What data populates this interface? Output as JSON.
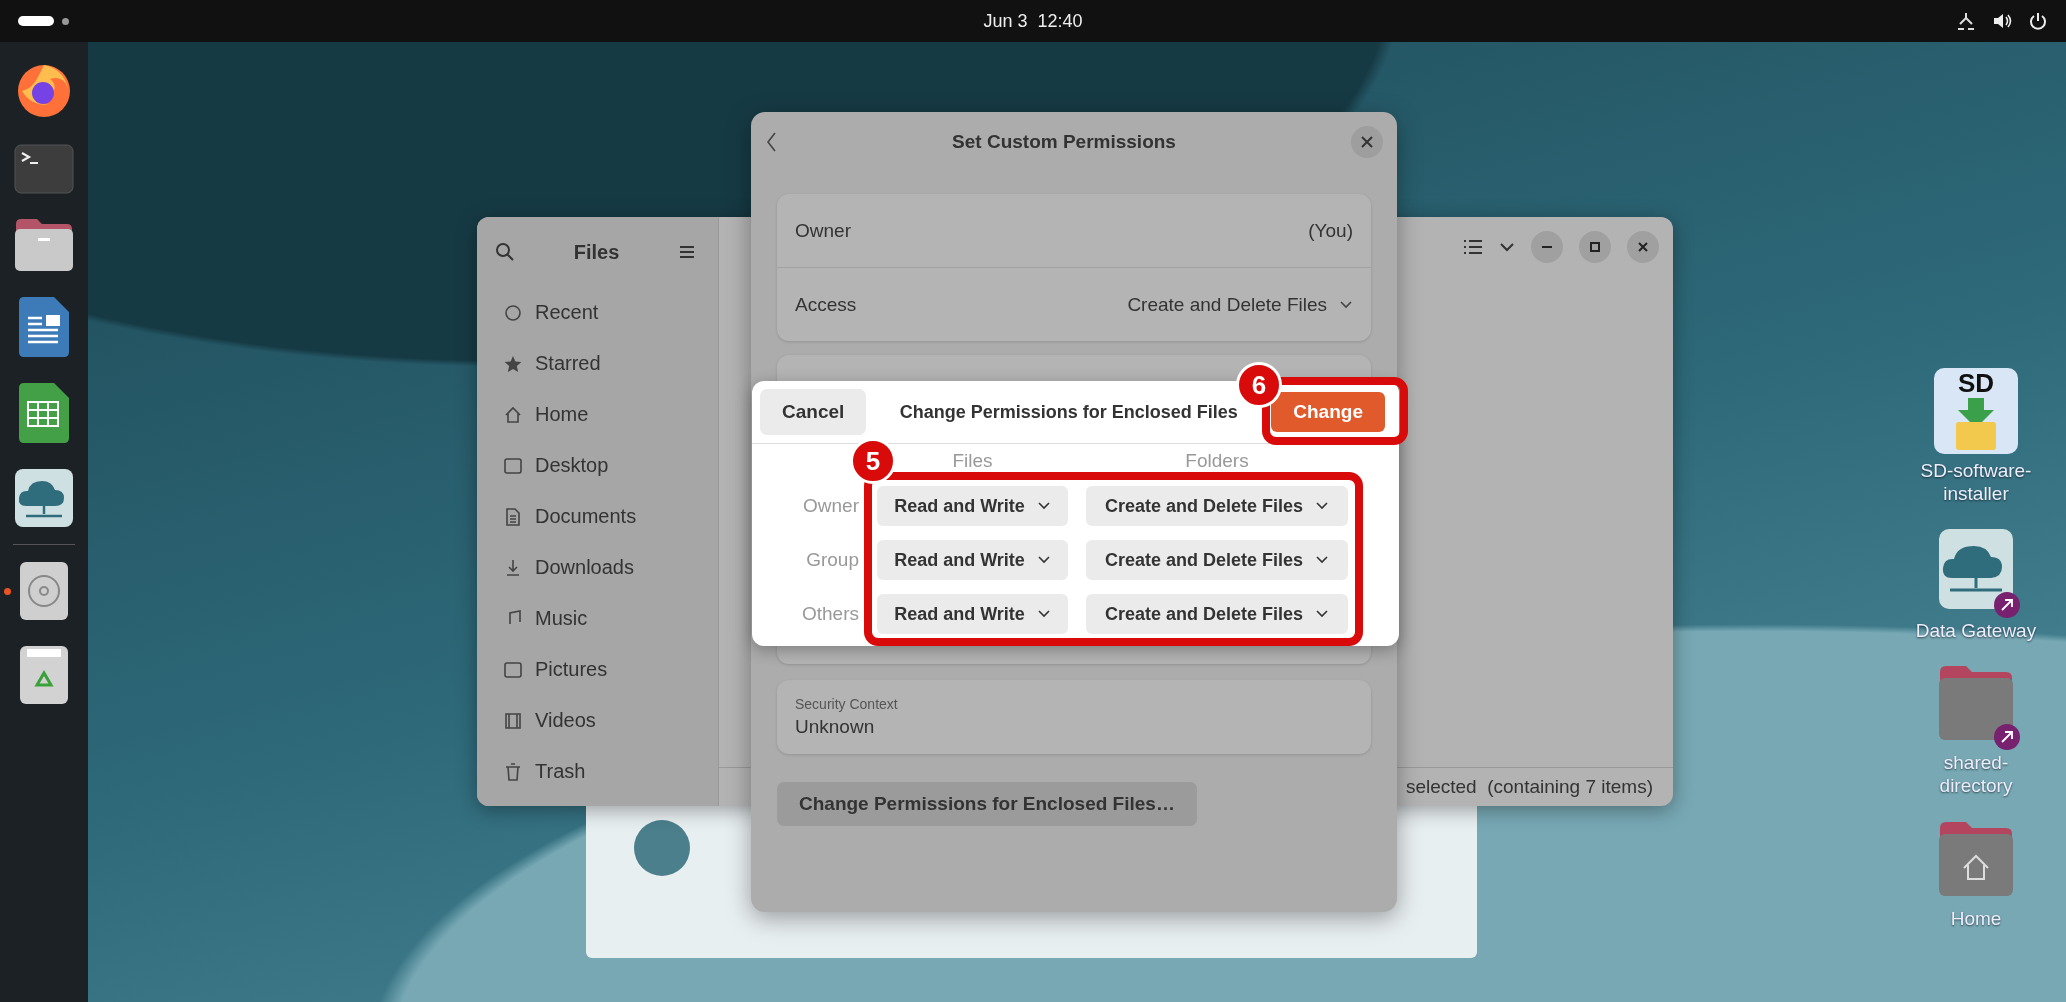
{
  "top_bar": {
    "clock": "Jun 3  12:40"
  },
  "dock": {
    "favorites": [
      {
        "running": false
      },
      {
        "running": false
      },
      {
        "running": false
      },
      {
        "running": false
      },
      {
        "running": false
      },
      {
        "running": false
      }
    ],
    "others": [
      {
        "running": true
      },
      {
        "running": false
      }
    ]
  },
  "files_window": {
    "title": "Files",
    "sidebar": [
      {
        "label": "Recent"
      },
      {
        "label": "Starred"
      },
      {
        "label": "Home"
      },
      {
        "label": "Desktop"
      },
      {
        "label": "Documents"
      },
      {
        "label": "Downloads"
      },
      {
        "label": "Music"
      },
      {
        "label": "Pictures"
      },
      {
        "label": "Videos"
      },
      {
        "label": "Trash"
      }
    ],
    "status": "selected  (containing 7 items)"
  },
  "permissions_dialog": {
    "title": "Set Custom Permissions",
    "owner": {
      "label": "Owner",
      "value": "(You)"
    },
    "access": {
      "label": "Access",
      "value": "Create and Delete Files"
    },
    "security_context": {
      "label": "Security Context",
      "value": "Unknown"
    },
    "enclosed_button": "Change Permissions for Enclosed Files…"
  },
  "enclosed_dialog": {
    "cancel": "Cancel",
    "title": "Change Permissions for Enclosed Files",
    "confirm": "Change",
    "columns": [
      "Files",
      "Folders"
    ],
    "rows": [
      {
        "label": "Owner",
        "files": "Read and Write",
        "folders": "Create and Delete Files"
      },
      {
        "label": "Group",
        "files": "Read and Write",
        "folders": "Create and Delete Files"
      },
      {
        "label": "Others",
        "files": "Read and Write",
        "folders": "Create and Delete Files"
      }
    ]
  },
  "annotations": {
    "dropdowns_marker": "5",
    "change_marker": "6"
  },
  "desktop_icons": [
    {
      "label": "SD-software-installer",
      "logo_text": "SD",
      "shortcut": false
    },
    {
      "label": "Data Gateway",
      "shortcut": true
    },
    {
      "label": "shared-directory",
      "shortcut": true
    },
    {
      "label": "Home",
      "shortcut": false
    }
  ]
}
